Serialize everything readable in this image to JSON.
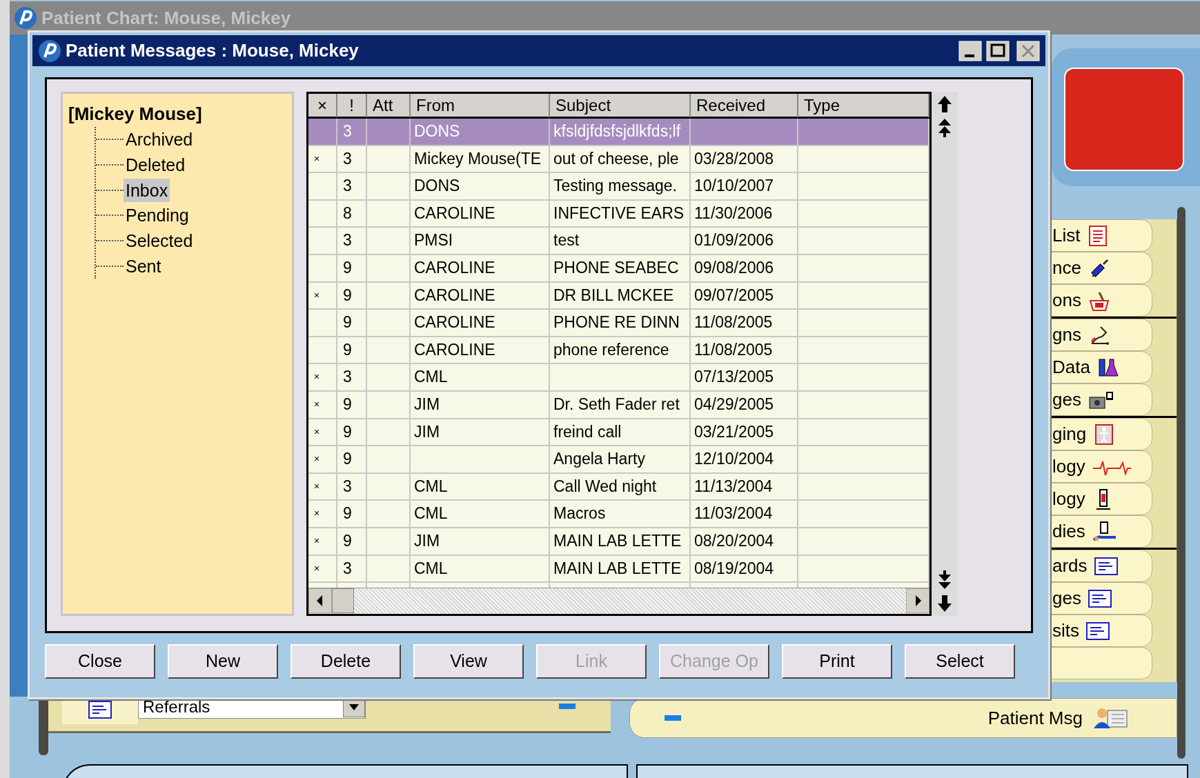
{
  "background_window": {
    "title": "Patient Chart: Mouse, Mickey"
  },
  "dialog": {
    "title": "Patient Messages : Mouse, Mickey"
  },
  "folder_tree": {
    "root": "[Mickey Mouse]",
    "children": [
      {
        "label": "Archived",
        "selected": false
      },
      {
        "label": "Deleted",
        "selected": false
      },
      {
        "label": "Inbox",
        "selected": true
      },
      {
        "label": "Pending",
        "selected": false
      },
      {
        "label": "Selected",
        "selected": false
      },
      {
        "label": "Sent",
        "selected": false
      }
    ]
  },
  "table": {
    "columns": [
      "×",
      "!",
      "Att",
      "From",
      "Subject",
      "Received",
      "Type"
    ],
    "rows": [
      {
        "selected": true,
        "priority": "3",
        "from": "DONS",
        "subject": "kfsldjfdsfsjdlkfds;lf"
      },
      {
        "selected": false,
        "flag": "×",
        "priority": "3",
        "from": "Mickey Mouse(TE",
        "subject": "out of cheese, ple",
        "received": "03/28/2008"
      },
      {
        "selected": false,
        "priority": "3",
        "from": "DONS",
        "subject": "Testing message.",
        "received": "10/10/2007"
      },
      {
        "selected": false,
        "priority": "8",
        "from": "CAROLINE",
        "subject": "INFECTIVE EARS",
        "received": "11/30/2006"
      },
      {
        "selected": false,
        "priority": "3",
        "from": "PMSI",
        "subject": "test",
        "received": "01/09/2006"
      },
      {
        "selected": false,
        "priority": "9",
        "from": "CAROLINE",
        "subject": "PHONE SEABEC",
        "received": "09/08/2006"
      },
      {
        "selected": false,
        "flag": "×",
        "priority": "9",
        "from": "CAROLINE",
        "subject": "DR BILL MCKEE",
        "received": "09/07/2005"
      },
      {
        "selected": false,
        "priority": "9",
        "from": "CAROLINE",
        "subject": "PHONE RE DINN",
        "received": "11/08/2005"
      },
      {
        "selected": false,
        "priority": "9",
        "from": "CAROLINE",
        "subject": "phone reference",
        "received": "11/08/2005"
      },
      {
        "selected": false,
        "flag": "×",
        "priority": "3",
        "from": "CML",
        "received": "07/13/2005"
      },
      {
        "selected": false,
        "flag": "×",
        "priority": "9",
        "from": "JIM",
        "subject": "Dr. Seth Fader ret",
        "received": "04/29/2005"
      },
      {
        "selected": false,
        "flag": "×",
        "priority": "9",
        "from": "JIM",
        "subject": "freind call",
        "received": "03/21/2005"
      },
      {
        "selected": false,
        "flag": "×",
        "priority": "9",
        "subject": "Angela Harty",
        "received": "12/10/2004"
      },
      {
        "selected": false,
        "flag": "×",
        "priority": "3",
        "from": "CML",
        "subject": "Call Wed night",
        "received": "11/13/2004"
      },
      {
        "selected": false,
        "flag": "×",
        "priority": "9",
        "from": "CML",
        "subject": "Macros",
        "received": "11/03/2004"
      },
      {
        "selected": false,
        "flag": "×",
        "priority": "9",
        "from": "JIM",
        "subject": "MAIN LAB LETTE",
        "received": "08/20/2004"
      },
      {
        "selected": false,
        "flag": "×",
        "priority": "3",
        "from": "CML",
        "subject": "MAIN LAB LETTE",
        "received": "08/19/2004"
      }
    ]
  },
  "buttons": [
    {
      "label": "Close",
      "disabled": false
    },
    {
      "label": "New",
      "disabled": false
    },
    {
      "label": "Delete",
      "disabled": false
    },
    {
      "label": "View",
      "disabled": false
    },
    {
      "label": "Link",
      "disabled": true
    },
    {
      "label": "Change Op",
      "disabled": true
    },
    {
      "label": "Print",
      "disabled": false
    },
    {
      "label": "Select",
      "disabled": false
    }
  ],
  "side_tab_groups": [
    {
      "tabs": [
        {
          "label": "List",
          "kind": "list"
        },
        {
          "label": "nce",
          "kind": "syringe"
        },
        {
          "label": "ons",
          "kind": "rx"
        }
      ]
    },
    {
      "tabs": [
        {
          "label": "gns",
          "kind": "stethoscope"
        },
        {
          "label": "Data",
          "kind": "flask"
        },
        {
          "label": "ges",
          "kind": "camera"
        }
      ]
    },
    {
      "tabs": [
        {
          "label": "ging",
          "kind": "body"
        },
        {
          "label": "logy",
          "kind": "ecg"
        },
        {
          "label": "logy",
          "kind": "tube"
        },
        {
          "label": "dies",
          "kind": "device"
        }
      ]
    },
    {
      "tabs": [
        {
          "label": "ards",
          "kind": "doc"
        },
        {
          "label": "ges",
          "kind": "doc"
        },
        {
          "label": "sits",
          "kind": "doc"
        },
        {
          "kind": "blank"
        }
      ]
    }
  ],
  "referrals_bar": {
    "value": "Referrals"
  },
  "patient_msg_tab": {
    "label": "Patient Msg"
  }
}
